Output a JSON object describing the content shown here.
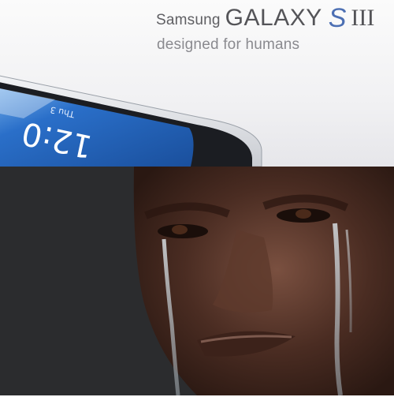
{
  "top_panel": {
    "brand": {
      "maker": "Samsung",
      "model": "GALAXY",
      "model_mark": "S",
      "model_numeral": "III"
    },
    "tagline": "designed for humans",
    "phone_screen": {
      "time": "12:0",
      "date": "Thu 3"
    }
  },
  "bottom_panel": {
    "subject": "crying-man-photo"
  },
  "colors": {
    "screen_blue": "#2a6fc9",
    "brand_accent": "#4c6fb3",
    "background_dark": "#2b2c2e"
  }
}
